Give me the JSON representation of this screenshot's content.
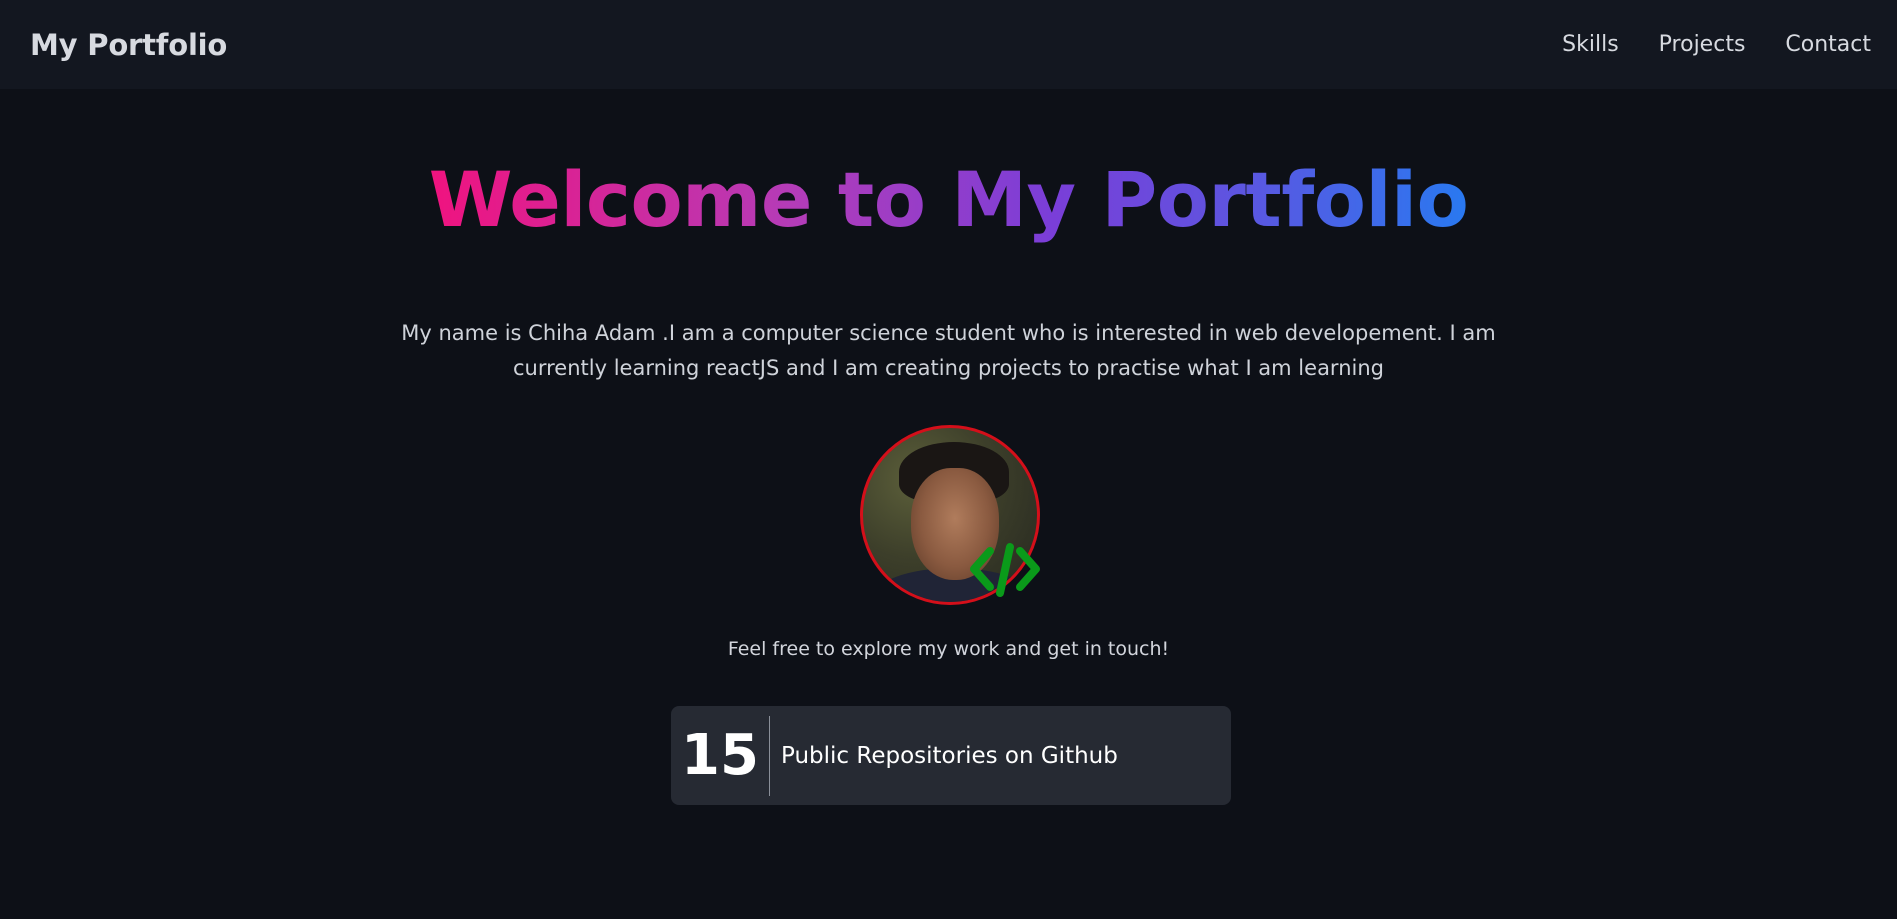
{
  "navbar": {
    "brand": "My Portfolio",
    "links": [
      "Skills",
      "Projects",
      "Contact"
    ]
  },
  "hero": {
    "title": "Welcome to My Portfolio",
    "intro": "My name is Chiha Adam .I am a computer science student who is interested in web developement. I am currently learning reactJS and I am creating projects to practise what I am learning",
    "avatar_icon": "profile-photo",
    "badge_icon": "code-icon",
    "tagline": "Feel free to explore my work and get in touch!"
  },
  "github": {
    "repo_count": "15",
    "repo_label": "Public Repositories on Github"
  },
  "colors": {
    "background": "#0d1017",
    "navbar": "#131720",
    "card": "#262a33",
    "gradient_start": "#f0137f",
    "gradient_end": "#2979f0",
    "avatar_border": "#d40f1a",
    "code_icon": "#0a9a1a"
  }
}
